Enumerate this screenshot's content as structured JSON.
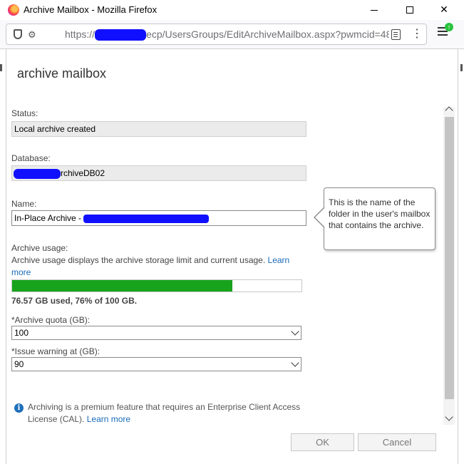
{
  "window": {
    "title": "Archive Mailbox - Mozilla Firefox",
    "minimize": "",
    "maximize": "",
    "close": "✕"
  },
  "urlbar": {
    "scheme": "https://",
    "path": "ecp/UsersGroups/EditArchiveMailbox.aspx?pwmcid=48",
    "permissions_icon": "⚙"
  },
  "dialog": {
    "title": "archive mailbox",
    "status_label": "Status:",
    "status_value": "Local archive created",
    "database_label": "Database:",
    "database_value": "rchiveDB02",
    "name_label": "Name:",
    "name_value": "In-Place Archive - ",
    "usage_label": "Archive usage:",
    "usage_desc": "Archive usage displays the archive storage limit and current usage.",
    "usage_learn_more": "Learn more",
    "usage_percent": 76,
    "usage_text": "76.57 GB used, 76% of 100 GB.",
    "quota_label": "*Archive quota (GB):",
    "quota_value": "100",
    "warning_label": "*Issue warning at (GB):",
    "warning_value": "90",
    "info_text": "Archiving is a premium feature that requires an Enterprise Client Access License (CAL).",
    "info_learn_more": "Learn more",
    "ok_label": "OK",
    "cancel_label": "Cancel"
  },
  "tooltip": {
    "text": "This is the name of the folder in the user's mailbox that contains the archive."
  },
  "colors": {
    "progress": "#17a31b",
    "link": "#1a6bb8",
    "redaction": "#1010ff"
  }
}
